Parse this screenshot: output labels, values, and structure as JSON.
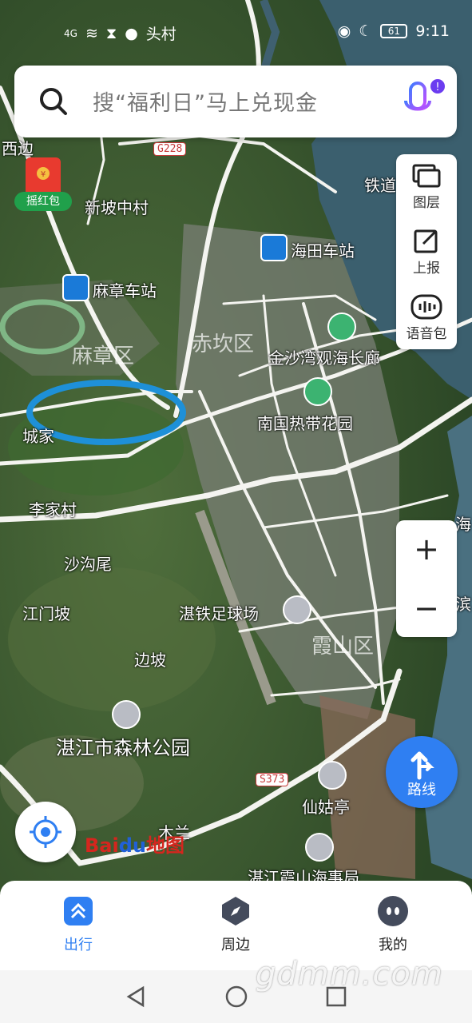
{
  "status_bar": {
    "left_text": "头村",
    "signal": "4G",
    "time": "9:11",
    "battery": "61"
  },
  "search": {
    "placeholder": "搜“福利日”马上兑现金"
  },
  "tools": {
    "layers": "图层",
    "report": "上报",
    "voice_pack": "语音包"
  },
  "red_packet": {
    "label": "摇红包"
  },
  "zoom": {
    "in": "+",
    "out": "−"
  },
  "route_button": {
    "label": "路线"
  },
  "logo": {
    "part1": "Bai",
    "part2": "du",
    "part3": "地图"
  },
  "map_labels": {
    "xibian": "西边",
    "g228": "G228",
    "xinpo": "新坡中村",
    "tiedao": "铁道",
    "haitian": "海田车站",
    "mazhang_station": "麻章车站",
    "mazhang_district": "麻章区",
    "chikan": "赤坎区",
    "jinsha": "金沙湾观海长廊",
    "nanguo": "南国热带花园",
    "cheng": "城家",
    "lijia": "李家村",
    "shagou": "沙沟尾",
    "jiangmen": "江门坡",
    "zhantie": "湛铁足球场",
    "xiashan": "霞山区",
    "bianpo": "边坡",
    "forest_park": "湛江市森林公园",
    "s373": "S373",
    "xiangu": "仙姑亭",
    "mulan": "木兰",
    "haishi": "湛江霞山海事局",
    "bin": "滨",
    "hai": "海"
  },
  "bottom_nav": {
    "travel": "出行",
    "nearby": "周边",
    "mine": "我的"
  },
  "watermark": "gdmm.com",
  "colors": {
    "accent": "#2f7ff2",
    "highlight_green": "#7fb685",
    "highlight_blue": "#1e90d8",
    "bus_icon": "#1a7ad8",
    "park_icon": "#3cb371"
  }
}
